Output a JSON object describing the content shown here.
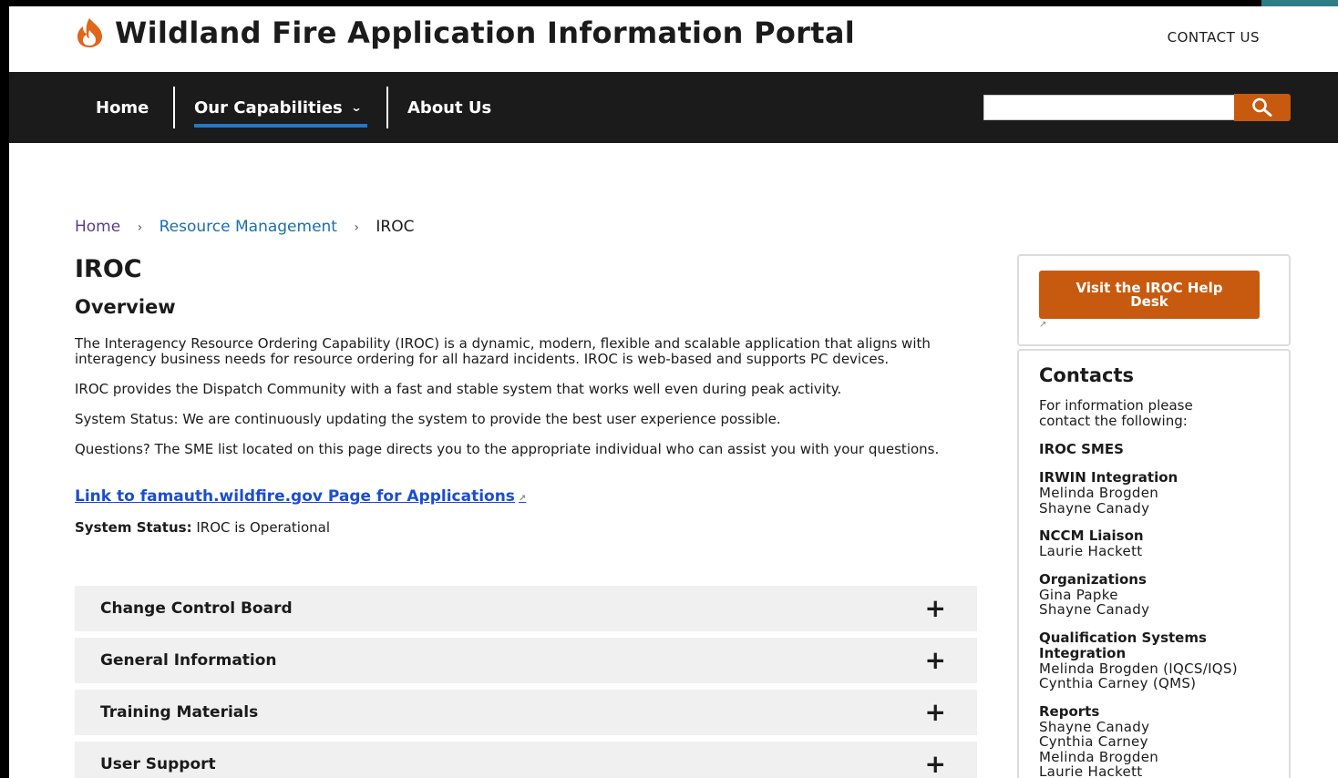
{
  "site": {
    "title": "Wildland Fire Application Information Portal",
    "contact": "CONTACT US"
  },
  "nav": {
    "home": "Home",
    "capabilities": "Our Capabilities",
    "about": "About Us"
  },
  "search": {
    "value": "",
    "placeholder": ""
  },
  "breadcrumb": {
    "home": "Home",
    "resource": "Resource Management",
    "current": "IROC"
  },
  "main": {
    "title": "IROC",
    "overview": "Overview",
    "p1": "The Interagency Resource Ordering Capability (IROC) is a dynamic, modern, flexible and scalable application that aligns with interagency business needs for resource ordering for all hazard incidents. IROC is web-based and supports PC devices.",
    "p2": "IROC provides the Dispatch Community with a fast and stable system that works well even during peak activity.",
    "p3": "System Status: We are continuously updating the system to provide the best user experience possible.",
    "p4": "Questions? The SME list located on this page directs you to the appropriate individual who can assist you with your questions.",
    "link": "Link to famauth.wildfire.gov Page for Applications",
    "status_label": "System Status:",
    "status_value": "IROC is Operational"
  },
  "accordion": [
    {
      "label": "Change Control Board"
    },
    {
      "label": "General Information"
    },
    {
      "label": "Training Materials"
    },
    {
      "label": "User Support"
    }
  ],
  "sidebar": {
    "help_button": "Visit the IROC Help Desk",
    "contacts_title": "Contacts",
    "contacts_intro": "For information please contact the following:",
    "sme_title": "IROC SMES",
    "groups": [
      {
        "title": "IRWIN Integration",
        "names": [
          "Melinda Brogden",
          "Shayne Canady"
        ]
      },
      {
        "title": "NCCM Liaison",
        "names": [
          "Laurie Hackett"
        ]
      },
      {
        "title": "Organizations",
        "names": [
          "Gina Papke",
          "Shayne Canady"
        ]
      },
      {
        "title": "Qualification Systems Integration",
        "names": [
          "Melinda Brogden (IQCS/IQS)",
          "Cynthia Carney (QMS)"
        ]
      },
      {
        "title": "Reports",
        "names": [
          "Shayne Canady",
          "Cynthia Carney",
          "Melinda Brogden",
          "Laurie Hackett"
        ]
      }
    ]
  },
  "colors": {
    "accent_orange": "#c85a10",
    "nav_bg": "#1b1b1b",
    "nav_active": "#2478c6",
    "link_blue": "#1a4ecf",
    "accordion_bg": "#f0f0f0"
  },
  "icons": [
    "flame-icon",
    "chevron-down-icon",
    "search-icon",
    "external-link-icon",
    "plus-icon"
  ]
}
